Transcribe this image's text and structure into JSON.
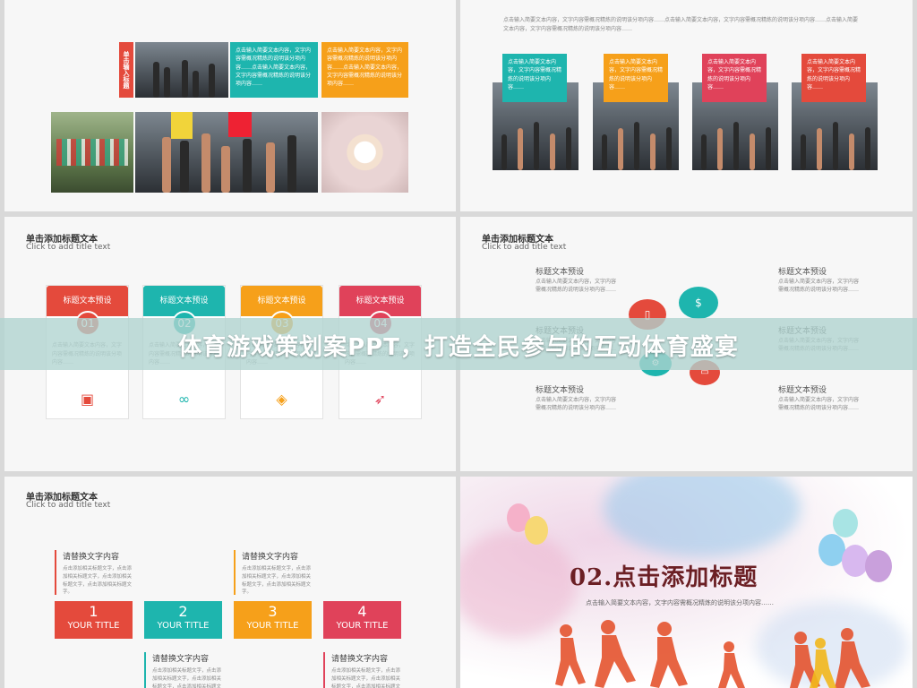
{
  "banner": {
    "text": "体育游戏策划案PPT，打造全民参与的互动体育盛宴"
  },
  "slide1": {
    "vertical_label": "单击输入标题",
    "box_teal": "点击输入简要文本内容，文字内容需概况精炼的说明该分项内容……点击输入简要文本内容，文字内容需概况精炼的说明该分项内容……",
    "box_orange": "点击输入简要文本内容，文字内容需概况精炼的说明该分项内容……点击输入简要文本内容，文字内容需概况精炼的说明该分项内容……"
  },
  "slide2": {
    "intro": "点击输入简要文本内容，文字内容需概况精炼的说明该分项内容……点击输入简要文本内容，文字内容需概况精炼的说明该分项内容……点击输入简要文本内容，文字内容需概况精炼的说明该分项内容……",
    "boxes": [
      {
        "text": "点击输入简要文本内容，文字内容需概况精炼的说明该分项内容……"
      },
      {
        "text": "点击输入简要文本内容，文字内容需概况精炼的说明该分项内容……"
      },
      {
        "text": "点击输入简要文本内容，文字内容需概况精炼的说明该分项内容……"
      },
      {
        "text": "点击输入简要文本内容，文字内容需概况精炼的说明该分项内容……"
      }
    ],
    "colors": [
      "#1eb5ae",
      "#f6a01a",
      "#e0425a",
      "#e44a3c"
    ]
  },
  "slide3": {
    "title": "单击添加标题文本",
    "subtitle": "Click to add title text",
    "cards": [
      {
        "head": "标题文本预设",
        "num": "01",
        "text": "点击输入简要文本内容，文字内容需概况精炼的说明该分项内容……",
        "icon": "presentation-icon",
        "glyph": "▣",
        "color": "#e44a3c"
      },
      {
        "head": "标题文本预设",
        "num": "02",
        "text": "点击输入简要文本内容，文字内容需概况精炼的说明该分项内容……",
        "icon": "binoculars-icon",
        "glyph": "∞",
        "color": "#1eb5ae"
      },
      {
        "head": "标题文本预设",
        "num": "03",
        "text": "点击输入简要文本内容，文字内容需概况精炼的说明该分项内容……",
        "icon": "layers-icon",
        "glyph": "◈",
        "color": "#f6a01a"
      },
      {
        "head": "标题文本预设",
        "num": "04",
        "text": "点击输入简要文本内容，文字内容需概况精炼的说明该分项内容……",
        "icon": "rocket-icon",
        "glyph": "➶",
        "color": "#e0425a"
      }
    ]
  },
  "slide4": {
    "title": "单击添加标题文本",
    "subtitle": "Click to add title text",
    "items": [
      {
        "label": "标题文本预设",
        "text": "点击输入简要文本内容，文字内容需概况精炼的说明该分项内容……"
      },
      {
        "label": "标题文本预设",
        "text": "点击输入简要文本内容，文字内容需概况精炼的说明该分项内容……"
      },
      {
        "label": "标题文本预设",
        "text": "点击输入简要文本内容，文字内容需概况精炼的说明该分项内容……"
      },
      {
        "label": "标题文本预设",
        "text": "点击输入简要文本内容，文字内容需概况精炼的说明该分项内容……"
      },
      {
        "label": "标题文本预设",
        "text": "点击输入简要文本内容，文字内容需概况精炼的说明该分项内容……"
      },
      {
        "label": "标题文本预设",
        "text": "点击输入简要文本内容，文字内容需概况精炼的说明该分项内容……"
      }
    ]
  },
  "slide5": {
    "title": "单击添加标题文本",
    "subtitle": "Click to add title text",
    "items": [
      {
        "head": "请替换文字内容",
        "text": "点击添加相关标题文字，点击添加相关标题文字，点击添加相关标题文字，点击添加相关标题文字。"
      },
      {
        "head": "请替换文字内容",
        "text": "点击添加相关标题文字，点击添加相关标题文字，点击添加相关标题文字，点击添加相关标题文字。"
      },
      {
        "head": "请替换文字内容",
        "text": "点击添加相关标题文字，点击添加相关标题文字，点击添加相关标题文字，点击添加相关标题文字。"
      },
      {
        "head": "请替换文字内容",
        "text": "点击添加相关标题文字，点击添加相关标题文字，点击添加相关标题文字，点击添加相关标题文字。"
      }
    ],
    "boxes": [
      {
        "n": "1",
        "label": "YOUR TITLE",
        "color": "#e44a3c"
      },
      {
        "n": "2",
        "label": "YOUR TITLE",
        "color": "#1eb5ae"
      },
      {
        "n": "3",
        "label": "YOUR TITLE",
        "color": "#f6a01a"
      },
      {
        "n": "4",
        "label": "YOUR TITLE",
        "color": "#e0425a"
      }
    ]
  },
  "slide6": {
    "heading": "02.点击添加标题",
    "text": "点击输入简要文本内容，文字内容需概况精炼的说明该分项内容……"
  }
}
